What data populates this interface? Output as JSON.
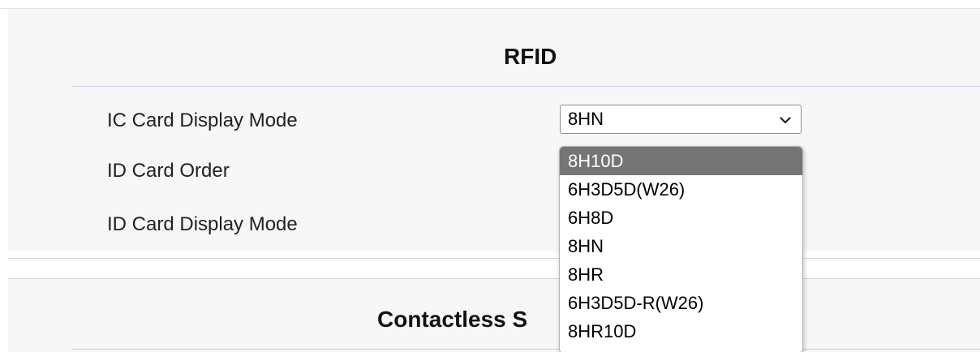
{
  "section_rfid": {
    "title": "RFID"
  },
  "fields": [
    {
      "label": "IC Card Display Mode",
      "value": "8HN"
    },
    {
      "label": "ID Card Order",
      "value": ""
    },
    {
      "label": "ID Card Display Mode",
      "value": ""
    }
  ],
  "dropdown": {
    "options": [
      "8H10D",
      "6H3D5D(W26)",
      "6H8D",
      "8HN",
      "8HR",
      "6H3D5D-R(W26)",
      "8HR10D"
    ],
    "highlighted": "8H10D"
  },
  "section_contactless": {
    "title_visible": "Contactless S"
  },
  "icons": {
    "select_arrow": "chevron-down-icon"
  }
}
